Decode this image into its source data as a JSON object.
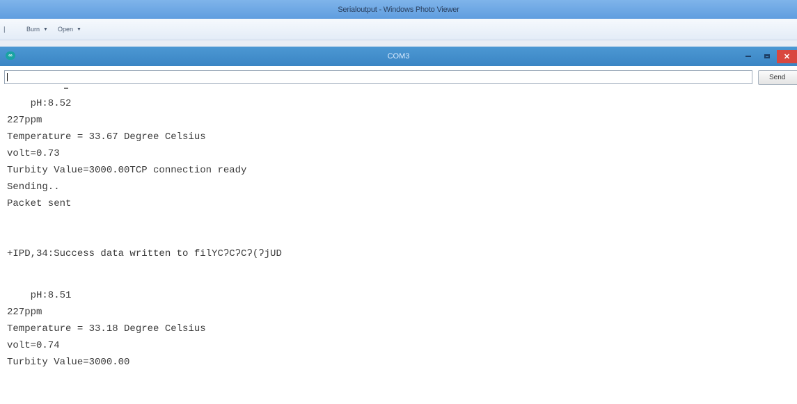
{
  "photo_viewer": {
    "title": "Serialoutput - Windows Photo Viewer",
    "menu": [
      {
        "label": "Burn"
      },
      {
        "label": "Open"
      }
    ]
  },
  "serial_window": {
    "title": "COM3",
    "send_label": "Send",
    "input_value": "",
    "lines": [
      "    pH:8.52",
      "227ppm",
      "Temperature = 33.67 Degree Celsius",
      "volt=0.73",
      "Turbity Value=3000.00TCP connection ready",
      "Sending..",
      "Packet sent",
      "+IPD,34:Success data written to filYCʔCʔCʔ(ʔjUD",
      "    pH:8.51",
      "227ppm",
      "Temperature = 33.18 Degree Celsius",
      "volt=0.74",
      "Turbity Value=3000.00"
    ]
  },
  "colors": {
    "photo_titlebar": "#6aa6e4",
    "com_titlebar": "#4290cc",
    "close_button": "#d9473f",
    "output_text": "#3a3a3a"
  },
  "icons": {
    "com_logo": "arduino-icon",
    "minimize": "minimize-icon",
    "maximize": "maximize-icon",
    "close": "close-icon"
  }
}
